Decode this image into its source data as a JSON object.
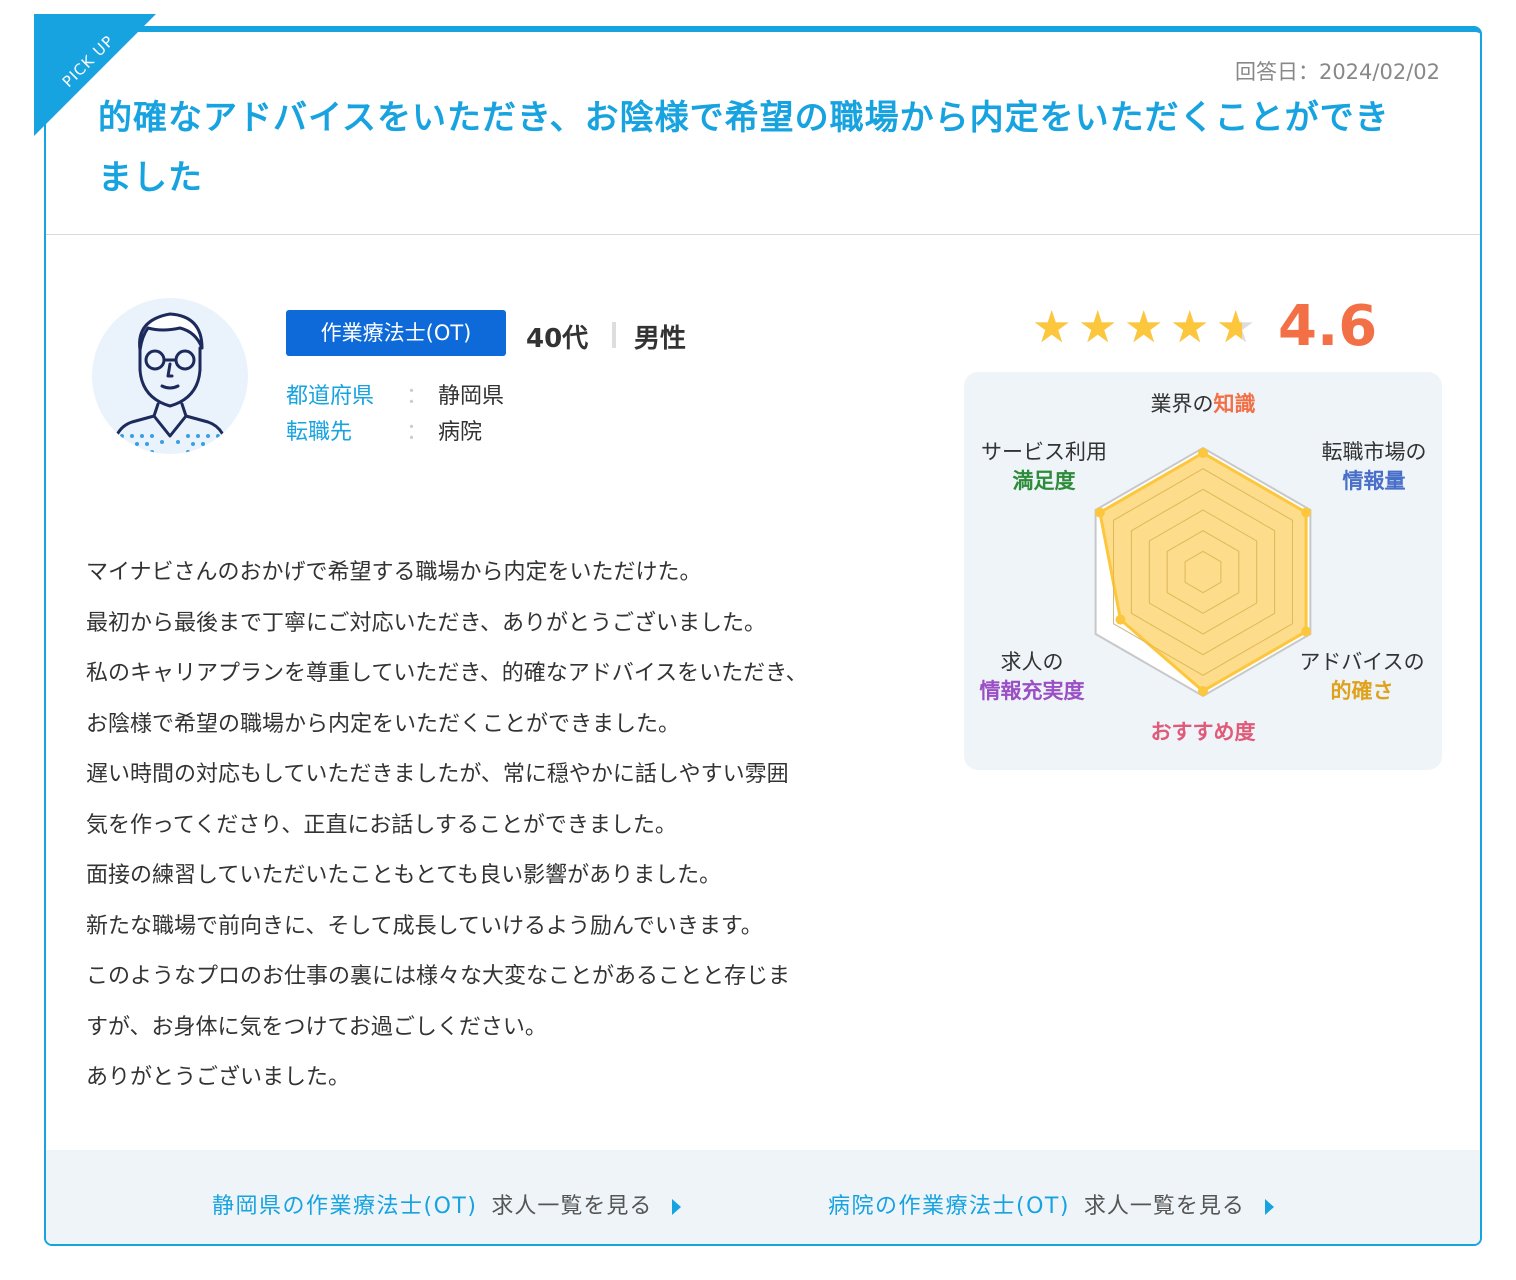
{
  "ribbon": {
    "label": "PICK UP"
  },
  "answer_date": "回答日：2024/02/02",
  "title_line1": "的確なアドバイスをいただき、お陰様で希望の職場から内定をいただくことができ",
  "title_line2": "ました",
  "profile": {
    "job_badge": "作業療法士(OT)",
    "age": "40代",
    "gender": "男性",
    "prefecture_label": "都道府県",
    "prefecture_value": "静岡県",
    "destination_label": "転職先",
    "destination_value": "病院",
    "colon": "："
  },
  "body_lines": [
    "マイナビさんのおかげで希望する職場から内定をいただけた。",
    "最初から最後まで丁寧にご対応いただき、ありがとうございました。",
    "私のキャリアプランを尊重していただき、的確なアドバイスをいただき、",
    "お陰様で希望の職場から内定をいただくことができました。",
    "遅い時間の対応もしていただきましたが、常に穏やかに話しやすい雰囲",
    "気を作ってくださり、正直にお話しすることができました。",
    "面接の練習していただいたこともとても良い影響がありました。",
    "新たな職場で前向きに、そして成長していけるよう励んでいきます。",
    "このようなプロのお仕事の裏には様々な大変なことがあることと存じま",
    "すが、お身体に気をつけてお過ごしください。",
    "ありがとうございました。"
  ],
  "rating": {
    "score": "4.6",
    "value": 4.6,
    "max": 5
  },
  "radar": {
    "labels": [
      {
        "plain": "業界の",
        "em": "知識",
        "em_color": "#f36f45"
      },
      {
        "plain": "転職市場の",
        "em": "情報量",
        "em_color": "#4a6fc9"
      },
      {
        "plain": "アドバイスの",
        "em": "的確さ",
        "em_color": "#e0a21b"
      },
      {
        "plain": "",
        "em": "おすすめ度",
        "em_color": "#e05a7a"
      },
      {
        "plain": "求人の",
        "em": "情報充実度",
        "em_color": "#9b4fc4"
      },
      {
        "plain": "サービス利用",
        "em": "満足度",
        "em_color": "#2e8b3a"
      }
    ],
    "values": [
      5,
      5,
      5,
      5,
      4,
      5
    ],
    "max": 5,
    "fill_color": "#fcc73d",
    "grid_color": "#c8c8c8"
  },
  "footer_links": [
    {
      "main": "静岡県の作業療法士(OT)",
      "suffix": "求人一覧を見る"
    },
    {
      "main": "病院の作業療法士(OT)",
      "suffix": "求人一覧を見る"
    }
  ],
  "colors": {
    "accent": "#17a3e0",
    "badge": "#0d6ad8",
    "score": "#f36f45",
    "star": "#fcc73d"
  }
}
